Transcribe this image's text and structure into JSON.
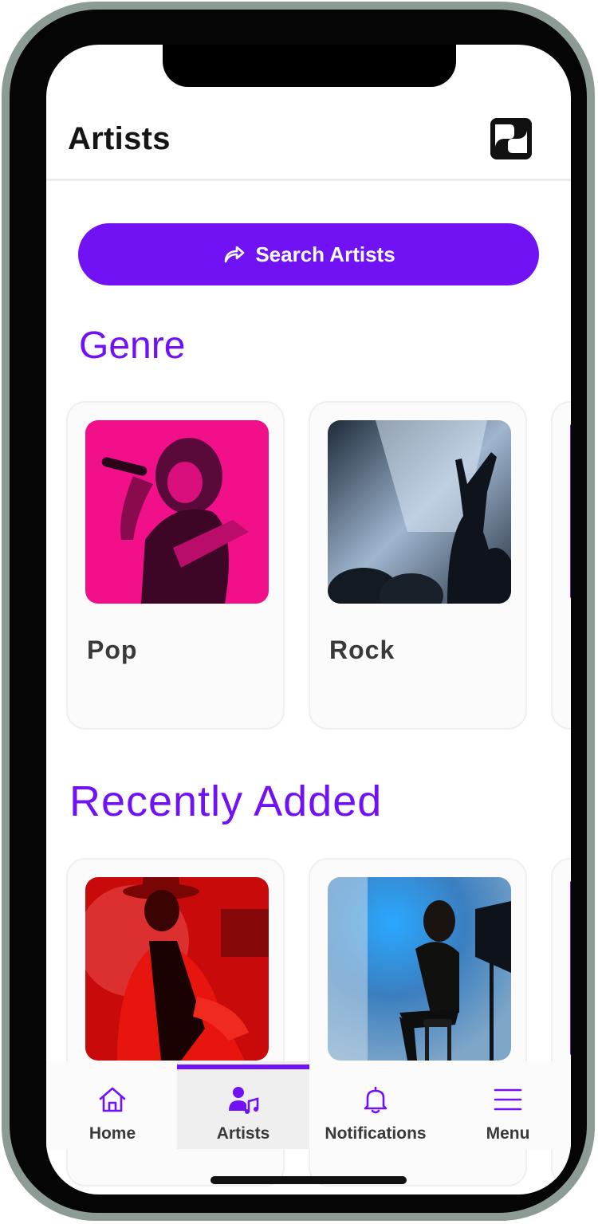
{
  "header": {
    "title": "Artists"
  },
  "search": {
    "label": "Search Artists"
  },
  "genre": {
    "title": "Genre",
    "cards": [
      {
        "label": "Pop"
      },
      {
        "label": "Rock"
      }
    ]
  },
  "recent": {
    "title": "Recently Added"
  },
  "tabbar": {
    "active": "Artists",
    "items": [
      {
        "label": "Home",
        "icon": "home-icon"
      },
      {
        "label": "Artists",
        "icon": "artist-music-icon"
      },
      {
        "label": "Notifications",
        "icon": "bell-icon"
      },
      {
        "label": "Menu",
        "icon": "menu-icon"
      }
    ]
  },
  "colors": {
    "accent": "#7012f4",
    "text": "#151515",
    "muted": "#3a3a3a"
  }
}
